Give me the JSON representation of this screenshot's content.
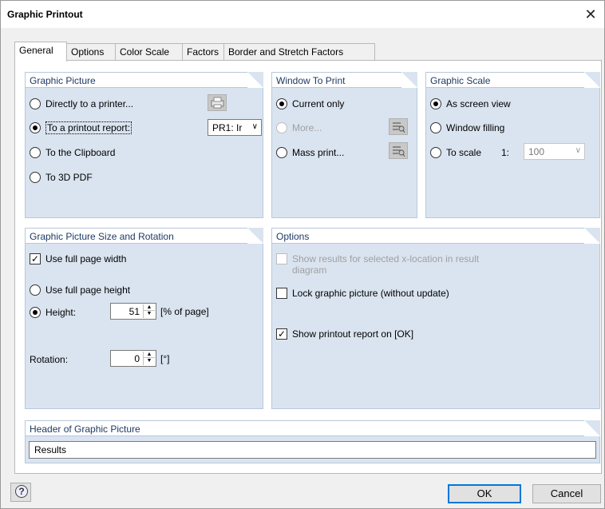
{
  "window": {
    "title": "Graphic Printout",
    "close_glyph": "✕"
  },
  "tabs": [
    {
      "label": "General",
      "active": true
    },
    {
      "label": "Options",
      "active": false
    },
    {
      "label": "Color Scale",
      "active": false
    },
    {
      "label": "Factors",
      "active": false
    },
    {
      "label": "Border and Stretch Factors",
      "active": false
    }
  ],
  "graphic_picture": {
    "header": "Graphic Picture",
    "options": [
      {
        "label": "Directly to a printer...",
        "selected": false
      },
      {
        "label": "To a printout report:",
        "selected": true
      },
      {
        "label": "To the Clipboard",
        "selected": false
      },
      {
        "label": "To 3D PDF",
        "selected": false
      }
    ],
    "report_select_value": "PR1: Ir",
    "printer_icon": "printer-settings-icon"
  },
  "window_to_print": {
    "header": "Window To Print",
    "options": [
      {
        "label": "Current only",
        "selected": true,
        "enabled": true
      },
      {
        "label": "More...",
        "selected": false,
        "enabled": false
      },
      {
        "label": "Mass print...",
        "selected": false,
        "enabled": true
      }
    ],
    "select_icon": "select-windows-icon"
  },
  "graphic_scale": {
    "header": "Graphic Scale",
    "options": [
      {
        "label": "As screen view",
        "selected": true
      },
      {
        "label": "Window filling",
        "selected": false
      },
      {
        "label": "To scale",
        "selected": false
      }
    ],
    "ratio_prefix": "1:",
    "scale_value": "100"
  },
  "size_rotation": {
    "header": "Graphic Picture Size and Rotation",
    "full_width_label": "Use full page width",
    "full_width_checked": true,
    "full_height_label": "Use full page height",
    "full_height_selected": false,
    "height_label": "Height:",
    "height_selected": true,
    "height_value": "51",
    "height_unit": "[% of page]",
    "rotation_label": "Rotation:",
    "rotation_value": "0",
    "rotation_unit": "[°]"
  },
  "options": {
    "header": "Options",
    "show_results_label_line1": "Show results for selected x-location in result",
    "show_results_label_line2": "diagram",
    "show_results_checked": false,
    "lock_label": "Lock graphic picture (without update)",
    "lock_checked": false,
    "show_report_label": "Show printout report on [OK]",
    "show_report_checked": true
  },
  "header_picture": {
    "header": "Header of Graphic Picture",
    "value": "Results"
  },
  "footer": {
    "ok_label": "OK",
    "cancel_label": "Cancel",
    "help_icon": "help-icon"
  },
  "glyphs": {
    "dropdown": "∨",
    "spin_up": "▲",
    "spin_down": "▼",
    "check": "✓",
    "help": "?"
  }
}
